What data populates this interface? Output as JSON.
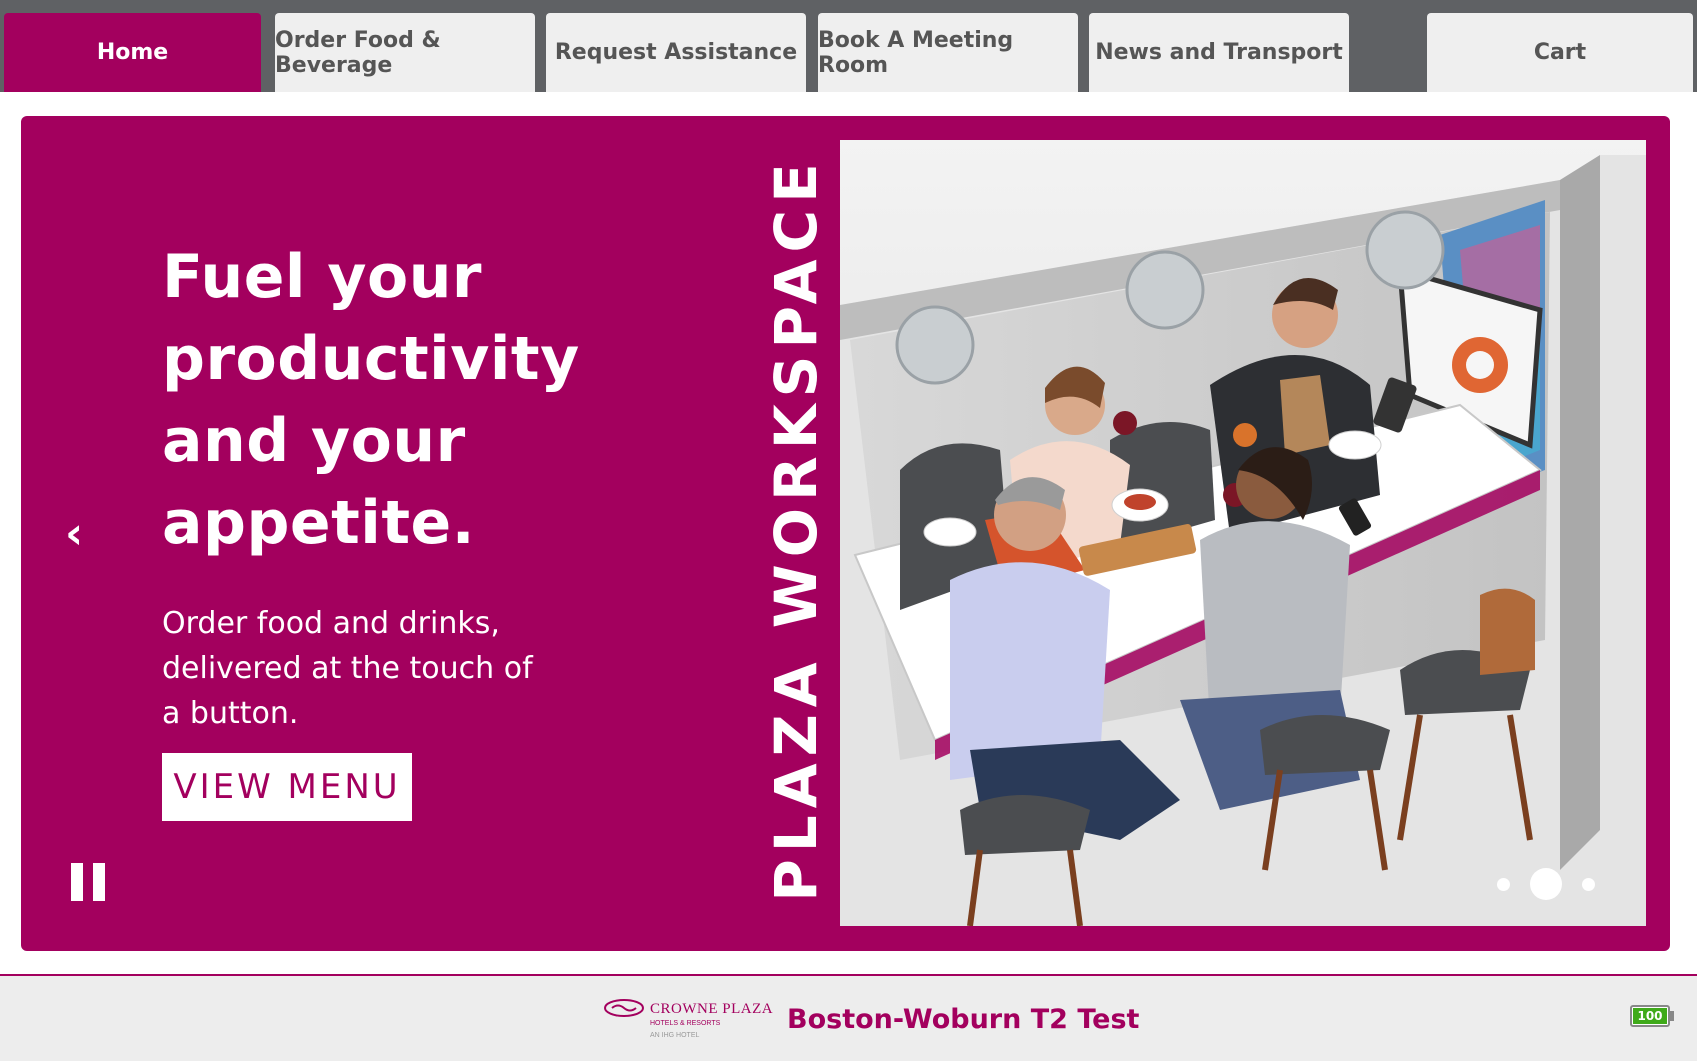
{
  "nav": {
    "tabs": [
      {
        "label": "Home",
        "active": true
      },
      {
        "label": "Order Food & Beverage",
        "active": false
      },
      {
        "label": "Request Assistance",
        "active": false
      },
      {
        "label": "Book A Meeting Room",
        "active": false
      },
      {
        "label": "News and Transport",
        "active": false
      },
      {
        "label": "Cart",
        "active": false
      }
    ]
  },
  "slide": {
    "headline": "Fuel your productivity and your appetite.",
    "subtext": "Order food and drinks, delivered at the touch of a button.",
    "cta_label": "VIEW MENU",
    "vertical_label": "PLAZA WORKSPACE",
    "prev_arrow": "‹",
    "next_arrow": "›",
    "pause_icon": "pause-icon",
    "total_slides": 3,
    "active_slide": 2
  },
  "footer": {
    "logo_text": "CROWNE PLAZA",
    "logo_sub": "HOTELS & RESORTS",
    "logo_sub2": "AN IHG HOTEL",
    "hotel_name": "Boston-Woburn T2 Test",
    "battery_level": "100"
  },
  "colors": {
    "brand": "#a3005e",
    "nav_bg": "#5f6164",
    "tab_bg": "#efefef"
  }
}
